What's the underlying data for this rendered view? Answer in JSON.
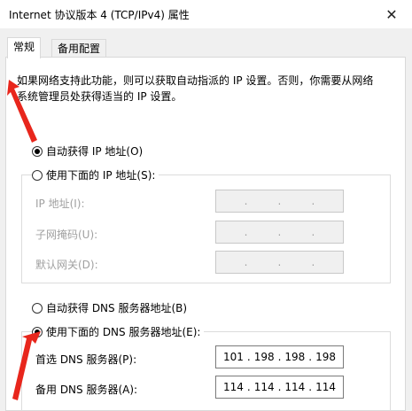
{
  "window": {
    "title": "Internet 协议版本 4 (TCP/IPv4) 属性",
    "close_glyph": "✕"
  },
  "tabs": [
    {
      "label": "常规",
      "active": true
    },
    {
      "label": "备用配置",
      "active": false
    }
  ],
  "description": "如果网络支持此功能，则可以获取自动指派的 IP 设置。否则，你需要从网络系统管理员处获得适当的 IP 设置。",
  "ip_section": {
    "auto_label": "自动获得 IP 地址(O)",
    "auto_checked": true,
    "manual_label": "使用下面的 IP 地址(S):",
    "manual_checked": false,
    "fields": [
      {
        "label": "IP 地址(I):",
        "octets": [
          "",
          "",
          "",
          ""
        ]
      },
      {
        "label": "子网掩码(U):",
        "octets": [
          "",
          "",
          "",
          ""
        ]
      },
      {
        "label": "默认网关(D):",
        "octets": [
          "",
          "",
          "",
          ""
        ]
      }
    ]
  },
  "dns_section": {
    "auto_label": "自动获得 DNS 服务器地址(B)",
    "auto_checked": false,
    "manual_label": "使用下面的 DNS 服务器地址(E):",
    "manual_checked": true,
    "fields": [
      {
        "label": "首选 DNS 服务器(P):",
        "octets": [
          "101",
          "198",
          "198",
          "198"
        ]
      },
      {
        "label": "备用 DNS 服务器(A):",
        "octets": [
          "114",
          "114",
          "114",
          "114"
        ]
      }
    ]
  },
  "colors": {
    "accent_arrow": "#e8261c",
    "dialog_bg": "#f0f0f0",
    "disabled_text": "#a0a0a0"
  },
  "icons": {
    "close": "close-icon",
    "annotation": "red-arrow-icon"
  }
}
